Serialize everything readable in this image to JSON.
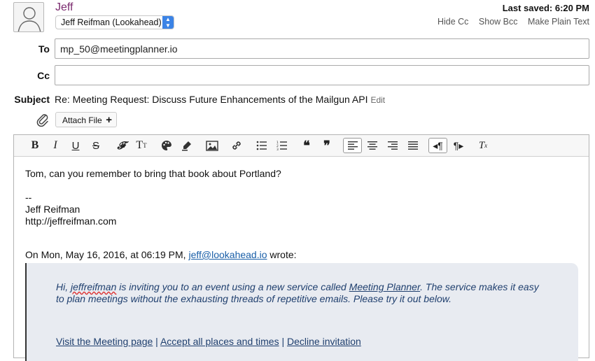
{
  "sender": {
    "name": "Jeff",
    "from_account": "Jeff Reifman (Lookahead)"
  },
  "header": {
    "last_saved": "Last saved: 6:20 PM",
    "hide_cc": "Hide Cc",
    "show_bcc": "Show Bcc",
    "make_plain_text": "Make Plain Text"
  },
  "fields": {
    "to_label": "To",
    "to_value": "mp_50@meetingplanner.io",
    "cc_label": "Cc",
    "cc_value": "",
    "subject_label": "Subject",
    "subject_value": "Re: Meeting Request: Discuss Future Enhancements of the Mailgun API",
    "subject_edit": "Edit"
  },
  "attach": {
    "label": "Attach File",
    "plus": "+"
  },
  "toolbar": {
    "bold": "B",
    "italic": "I",
    "underline": "U",
    "strike": "S",
    "font": "𝓕",
    "size": "T",
    "quote_open": "❝",
    "quote_close": "❞",
    "clear": "Tx"
  },
  "body": {
    "line1": "Tom, can you remember to bring that book about Portland?",
    "sig_sep": "--",
    "sig_name": "Jeff Reifman",
    "sig_url": "http://jeffreifman.com",
    "on_prefix": "On Mon, May 16, 2016, at 06:19 PM,",
    "on_email": "jeff@lookahead.io",
    "on_suffix": "wrote:"
  },
  "quote": {
    "t1": "Hi,",
    "t2": "jeffreifman",
    "t3": "is inviting you to an event using a new service called",
    "t4": "Meeting Planner",
    "t5": ". The service makes it easy to plan meetings without the exhausting threads of repetitive emails. Please try it out below.",
    "link1": "Visit the Meeting page",
    "sep": "|",
    "link2": "Accept all places and times",
    "link3": "Decline invitation"
  },
  "colors": {
    "sender_name": "#7a2a6e",
    "link": "#1a5fa8",
    "quote_bg": "#e8ebf1",
    "quote_text": "#1f3f6e",
    "select_accent": "#3b83e6"
  }
}
